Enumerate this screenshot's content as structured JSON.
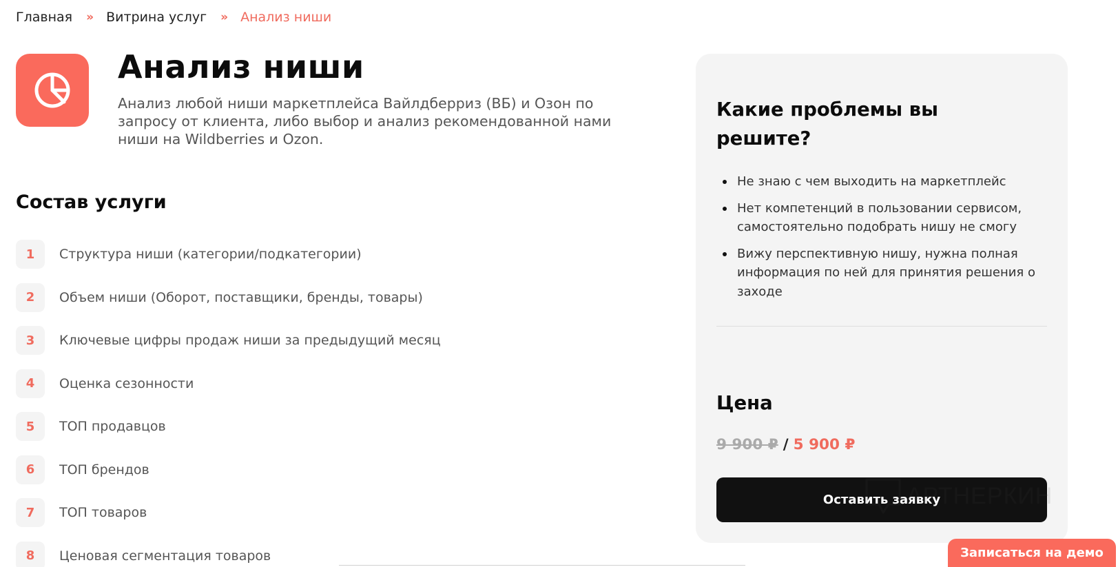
{
  "breadcrumb": {
    "items": [
      "Главная",
      "Витрина услуг",
      "Анализ ниши"
    ],
    "separator": "»"
  },
  "header": {
    "icon": "pie-chart-icon",
    "title": "Анализ ниши",
    "description": "Анализ любой ниши маркетплейса Вайлдберриз (ВБ) и Озон по запросу от клиента, либо выбор и анализ рекомендованной нами ниши на Wildberries и Ozon."
  },
  "composition": {
    "title": "Состав услуги",
    "items": [
      {
        "num": "1",
        "label": "Структура ниши (категории/подкатегории)"
      },
      {
        "num": "2",
        "label": "Объем ниши (Оборот, поставщики, бренды, товары)"
      },
      {
        "num": "3",
        "label": "Ключевые цифры продаж ниши за предыдущий месяц"
      },
      {
        "num": "4",
        "label": "Оценка сезонности"
      },
      {
        "num": "5",
        "label": "ТОП продавцов"
      },
      {
        "num": "6",
        "label": "ТОП брендов"
      },
      {
        "num": "7",
        "label": "ТОП товаров"
      },
      {
        "num": "8",
        "label": "Ценовая сегментация товаров"
      }
    ]
  },
  "sidebar": {
    "problems_title": "Какие проблемы вы решите?",
    "problems": [
      "Не знаю с чем выходить на маркетплейс",
      "Нет компетенций в пользовании сервисом, самостоятельно подобрать нишу не смогу",
      "Вижу перспективную нишу, нужна полная информация по ней для принятия решения о заходе"
    ],
    "price_title": "Цена",
    "price_old": "9 900 ₽",
    "price_separator": "/",
    "price_new": "5 900 ₽",
    "order_button": "Оставить заявку"
  },
  "watermark": "АРТНЕРКИН",
  "demo_button": "Записаться на демо",
  "colors": {
    "accent": "#fa6a5c",
    "accent_text": "#f06b5e",
    "card_bg": "#f4f4f4",
    "button_dark": "#111111"
  }
}
